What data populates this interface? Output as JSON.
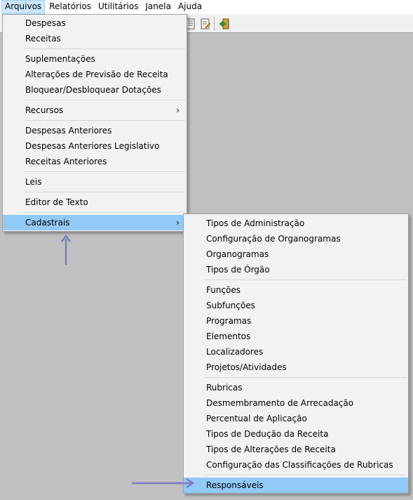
{
  "menubar": {
    "items": [
      {
        "label": "Arquivos"
      },
      {
        "label": "Relatórios"
      },
      {
        "label": "Utilitários"
      },
      {
        "label": "Janela"
      },
      {
        "label": "Ajuda"
      }
    ]
  },
  "toolbar": {
    "icons": [
      "report-icon",
      "edit-document-icon",
      "exit-door-icon"
    ]
  },
  "arquivos_menu": {
    "items": [
      "Despesas",
      "Receitas",
      "Suplementações",
      "Alterações de Previsão de Receita",
      "Bloquear/Desbloquear Dotações",
      "Recursos",
      "Despesas Anteriores",
      "Despesas Anteriores Legislativo",
      "Receitas Anteriores",
      "Leis",
      "Editor de Texto",
      "Cadastrais"
    ],
    "submenu_arrow": "›"
  },
  "cadastrais_menu": {
    "items": [
      "Tipos de Administração",
      "Configuração de Organogramas",
      "Organogramas",
      "Tipos de Órgão",
      "Funções",
      "Subfunções",
      "Programas",
      "Elementos",
      "Localizadores",
      "Projetos/Atividades",
      "Rubricas",
      "Desmembramento de Arrecadação",
      "Percentual de Aplicação",
      "Tipos de Dedução da Receita",
      "Tipos de Alterações de Receita",
      "Configuração das Classificações de Rubricas",
      "Responsáveis"
    ]
  },
  "colors": {
    "workspace": "#c0c0c0",
    "highlight": "#91c9f7",
    "annotation_arrow": "#7b7bbd"
  }
}
